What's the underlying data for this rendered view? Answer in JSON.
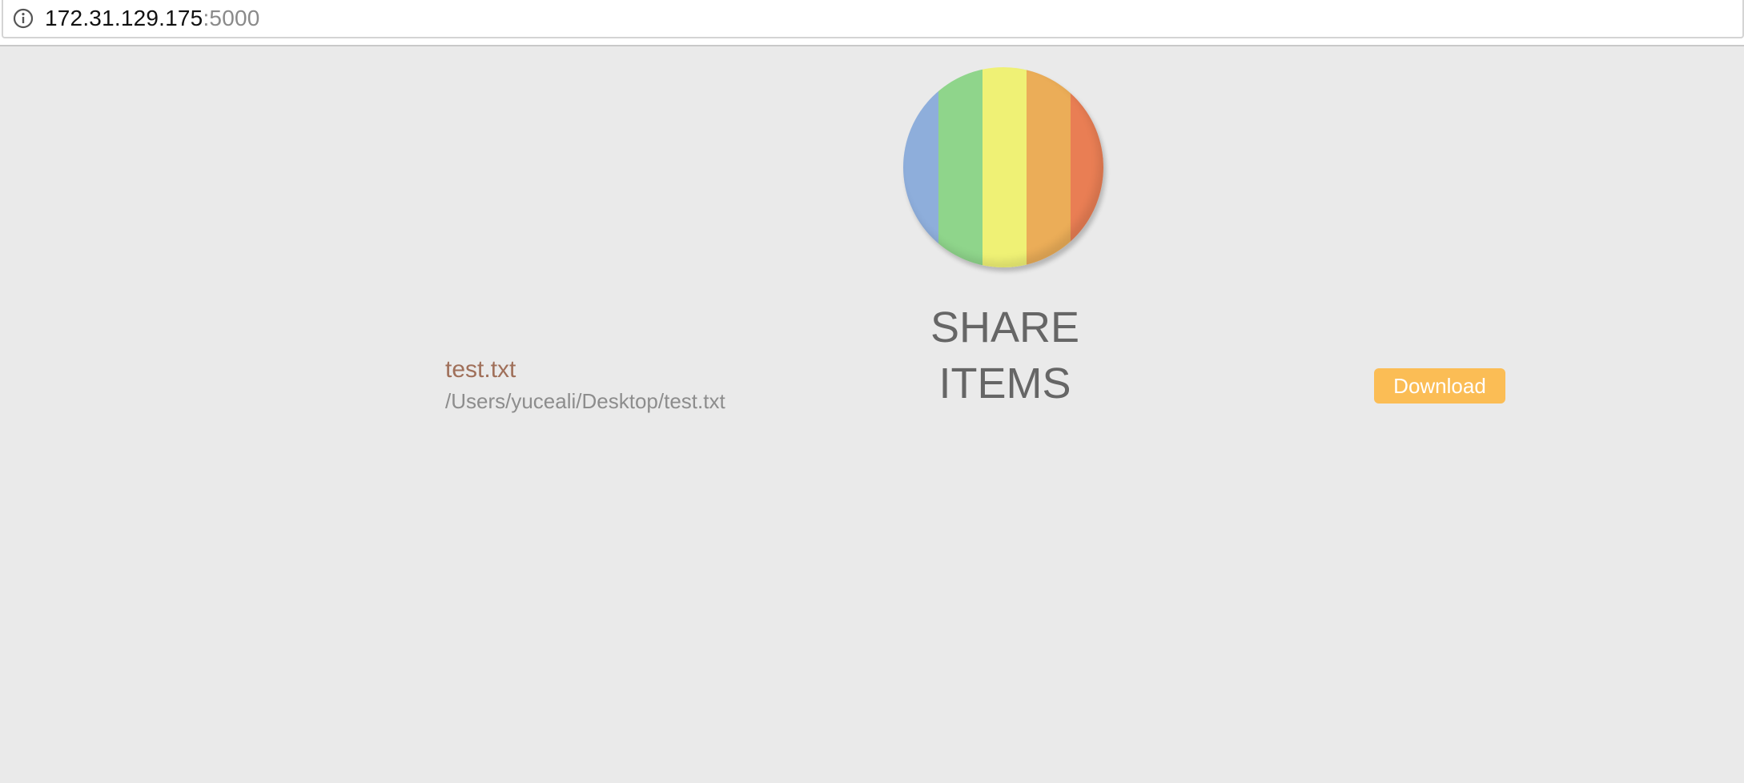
{
  "browser": {
    "address_host": "172.31.129.175",
    "address_port": ":5000",
    "info_icon": "info-circle-icon"
  },
  "logo": {
    "icon": "rainbow-stripes-logo",
    "stripe_colors": [
      "#8eaedb",
      "#8fd58b",
      "#eff175",
      "#ebad58",
      "#e97e54"
    ]
  },
  "page": {
    "heading": "SHARE ITEMS"
  },
  "items": [
    {
      "name": "test.txt",
      "path": "/Users/yuceali/Desktop/test.txt",
      "action_label": "Download"
    }
  ],
  "colors": {
    "background": "#eaeaea",
    "heading": "#666666",
    "item_name": "#a0705a",
    "item_path": "#8d8d8d",
    "button": "#fbbd55",
    "button_text": "#ffffff"
  }
}
